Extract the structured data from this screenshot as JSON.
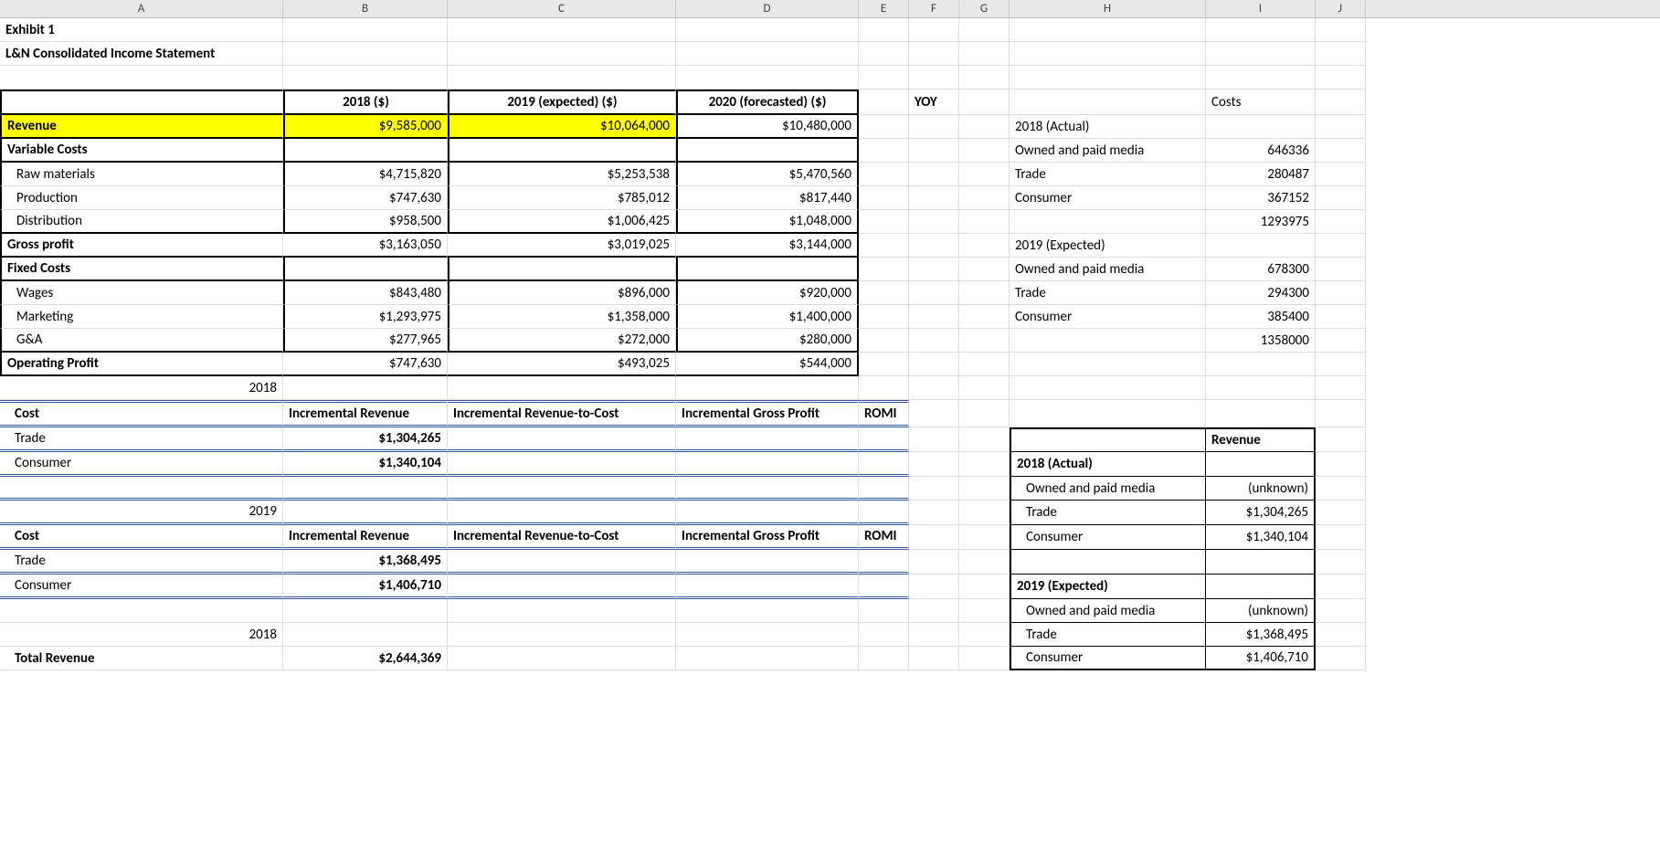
{
  "columns": [
    "A",
    "B",
    "C",
    "D",
    "E",
    "F",
    "G",
    "H",
    "I",
    "J"
  ],
  "title_lines": {
    "exhibit": "Exhibit 1",
    "subtitle": "L&N Consolidated Income Statement"
  },
  "income": {
    "headers": {
      "y2018": "2018 ($)",
      "y2019": "2019 (expected) ($)",
      "y2020": "2020 (forecasted) ($)"
    },
    "revenue_label": "Revenue",
    "revenue": {
      "y2018": "$9,585,000",
      "y2019": "$10,064,000",
      "y2020": "$10,480,000"
    },
    "variable_costs_label": "Variable Costs",
    "rows_var": [
      {
        "label": "Raw materials",
        "y2018": "$4,715,820",
        "y2019": "$5,253,538",
        "y2020": "$5,470,560"
      },
      {
        "label": "Production",
        "y2018": "$747,630",
        "y2019": "$785,012",
        "y2020": "$817,440"
      },
      {
        "label": "Distribution",
        "y2018": "$958,500",
        "y2019": "$1,006,425",
        "y2020": "$1,048,000"
      }
    ],
    "gross_profit_label": "Gross profit",
    "gross_profit": {
      "y2018": "$3,163,050",
      "y2019": "$3,019,025",
      "y2020": "$3,144,000"
    },
    "fixed_costs_label": "Fixed Costs",
    "rows_fixed": [
      {
        "label": "Wages",
        "y2018": "$843,480",
        "y2019": "$896,000",
        "y2020": "$920,000"
      },
      {
        "label": "Marketing",
        "y2018": "$1,293,975",
        "y2019": "$1,358,000",
        "y2020": "$1,400,000"
      },
      {
        "label": "G&A",
        "y2018": "$277,965",
        "y2019": "$272,000",
        "y2020": "$280,000"
      }
    ],
    "op_profit_label": "Operating Profit",
    "op_profit": {
      "y2018": "$747,630",
      "y2019": "$493,025",
      "y2020": "$544,000"
    }
  },
  "yoy_label": "YOY",
  "costs_sidebar": {
    "header": "Costs",
    "y2018_label": "2018 (Actual)",
    "y2018": [
      {
        "label": "Owned and paid media",
        "val": "646336"
      },
      {
        "label": "Trade",
        "val": "280487"
      },
      {
        "label": "Consumer",
        "val": "367152"
      },
      {
        "label": "",
        "val": "1293975"
      }
    ],
    "y2019_label": "2019 (Expected)",
    "y2019": [
      {
        "label": "Owned and paid media",
        "val": "678300"
      },
      {
        "label": "Trade",
        "val": "294300"
      },
      {
        "label": "Consumer",
        "val": "385400"
      },
      {
        "label": "",
        "val": "1358000"
      }
    ]
  },
  "incremental": {
    "year2018": "2018",
    "year2019": "2019",
    "cost_label": "Cost",
    "cols": {
      "b": "Incremental Revenue",
      "c": "Incremental Revenue-to-Cost",
      "d": "Incremental Gross Profit",
      "e": "ROMI"
    },
    "rows2018": [
      {
        "label": "Trade",
        "val": "$1,304,265"
      },
      {
        "label": "Consumer",
        "val": "$1,340,104"
      }
    ],
    "rows2019": [
      {
        "label": "Trade",
        "val": "$1,368,495"
      },
      {
        "label": "Consumer",
        "val": "$1,406,710"
      }
    ]
  },
  "bottom": {
    "year": "2018",
    "total_rev_label": "Total Revenue",
    "total_rev_val": "$2,644,369"
  },
  "revenue_box": {
    "header": "Revenue",
    "y2018_label": "2018 (Actual)",
    "y2018": [
      {
        "label": "Owned and paid media",
        "val": "(unknown)"
      },
      {
        "label": "Trade",
        "val": "$1,304,265"
      },
      {
        "label": "Consumer",
        "val": "$1,340,104"
      }
    ],
    "y2019_label": "2019 (Expected)",
    "y2019": [
      {
        "label": "Owned and paid media",
        "val": "(unknown)"
      },
      {
        "label": "Trade",
        "val": "$1,368,495"
      },
      {
        "label": "Consumer",
        "val": "$1,406,710"
      }
    ]
  }
}
